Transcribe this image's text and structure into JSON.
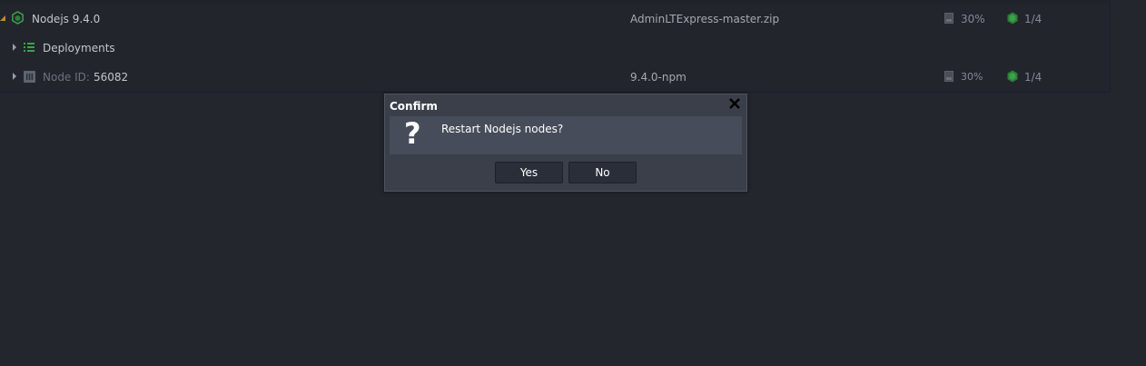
{
  "rows": [
    {
      "name": "Nodejs 9.4.0",
      "file": "AdminLTExpress-master.zip",
      "disk": "30%",
      "cloudlets": "1/4"
    },
    {
      "name": "Deployments"
    },
    {
      "label": "Node ID:",
      "value": "56082",
      "version": "9.4.0-npm",
      "disk": "30%",
      "cloudlets": "1/4"
    }
  ],
  "dialog": {
    "title": "Confirm",
    "icon": "question-icon",
    "question_glyph": "?",
    "message": "Restart Nodejs nodes?",
    "yes_label": "Yes",
    "no_label": "No",
    "close_glyph": "✕"
  },
  "colors": {
    "background": "#23262d",
    "accent_green": "#3aa34a",
    "caret_orange": "#c98a2c",
    "dialog_bg": "#3a3f4a"
  }
}
